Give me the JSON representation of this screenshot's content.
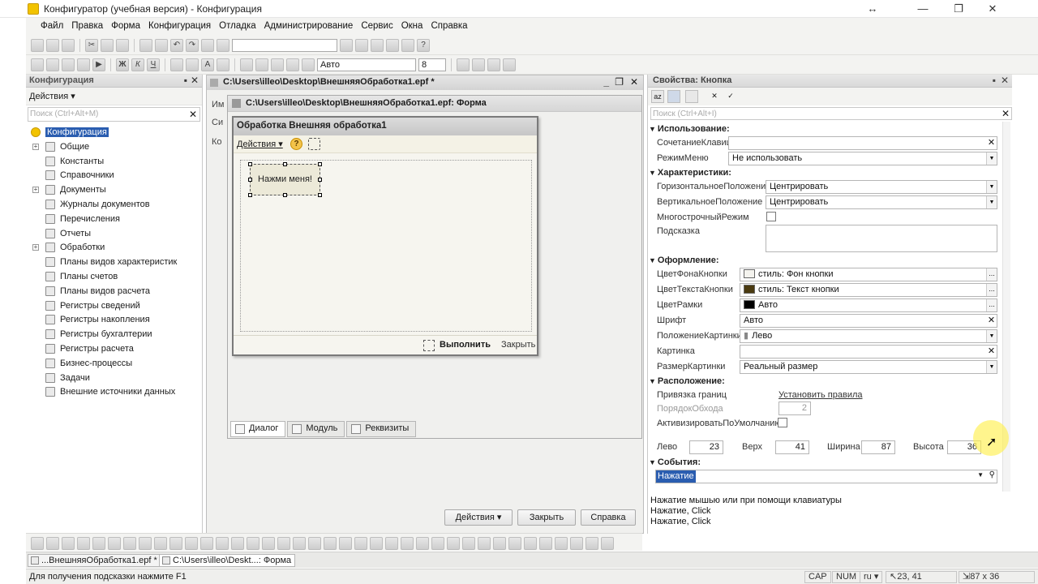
{
  "window": {
    "title": "Конфигуратор (учебная версия) - Конфигурация",
    "controls": [
      "↔",
      "—",
      "❐",
      "✕"
    ]
  },
  "menu": [
    "Файл",
    "Правка",
    "Форма",
    "Конфигурация",
    "Отладка",
    "Администрирование",
    "Сервис",
    "Окна",
    "Справка"
  ],
  "toolbar": {
    "font_name": "Авто",
    "font_size": "8"
  },
  "config_panel": {
    "title": "Конфигурация",
    "actions_label": "Действия",
    "search_placeholder": "Поиск (Ctrl+Alt+M)",
    "tree": [
      {
        "label": "Конфигурация",
        "root": true
      },
      {
        "label": "Общие",
        "expandable": true
      },
      {
        "label": "Константы"
      },
      {
        "label": "Справочники"
      },
      {
        "label": "Документы",
        "expandable": true
      },
      {
        "label": "Журналы документов"
      },
      {
        "label": "Перечисления"
      },
      {
        "label": "Отчеты"
      },
      {
        "label": "Обработки",
        "expandable": true
      },
      {
        "label": "Планы видов характеристик"
      },
      {
        "label": "Планы счетов"
      },
      {
        "label": "Планы видов расчета"
      },
      {
        "label": "Регистры сведений"
      },
      {
        "label": "Регистры накопления"
      },
      {
        "label": "Регистры бухгалтерии"
      },
      {
        "label": "Регистры расчета"
      },
      {
        "label": "Бизнес-процессы"
      },
      {
        "label": "Задачи"
      },
      {
        "label": "Внешние источники данных"
      }
    ]
  },
  "center_window": {
    "title": "C:\\Users\\illeo\\Desktop\\ВнешняяОбработка1.epf *",
    "side_labels": [
      "Им",
      "Си",
      "Ко"
    ],
    "buttons": {
      "actions": "Действия",
      "close": "Закрыть",
      "help": "Справка"
    }
  },
  "form_window": {
    "title": "C:\\Users\\illeo\\Desktop\\ВнешняяОбработка1.epf: Форма",
    "tabs": [
      "Диалог",
      "Модуль",
      "Реквизиты"
    ]
  },
  "processing_form": {
    "title": "Обработка  Внешняя обработка1",
    "actions_label": "Действия",
    "button_label": "Нажми меня!",
    "run_label": "Выполнить",
    "close_label": "Закрыть"
  },
  "properties": {
    "title": "Свойства: Кнопка",
    "search_placeholder": "Поиск (Ctrl+Alt+I)",
    "sections": {
      "usage": "Использование:",
      "characteristics": "Характеристики:",
      "appearance": "Оформление:",
      "location": "Расположение:",
      "events": "События:"
    },
    "rows": {
      "hotkey": {
        "label": "СочетаниеКлавиш",
        "value": ""
      },
      "menu_mode": {
        "label": "РежимМеню",
        "value": "Не использовать"
      },
      "h_pos": {
        "label": "ГоризонтальноеПоложение",
        "value": "Центрировать"
      },
      "v_pos": {
        "label": "ВертикальноеПоложение",
        "value": "Центрировать"
      },
      "multiline": {
        "label": "МногострочныйРежим"
      },
      "tooltip": {
        "label": "Подсказка",
        "value": ""
      },
      "bg_color": {
        "label": "ЦветФонаКнопки",
        "value": "стиль: Фон кнопки",
        "swatch": "#f4f3ee"
      },
      "text_color": {
        "label": "ЦветТекстаКнопки",
        "value": "стиль: Текст кнопки",
        "swatch": "#4a3a10"
      },
      "border_color": {
        "label": "ЦветРамки",
        "value": "Авто",
        "swatch": "#000000"
      },
      "font": {
        "label": "Шрифт",
        "value": "Авто"
      },
      "picture_pos": {
        "label": "ПоложениеКартинки",
        "value": "Лево"
      },
      "picture": {
        "label": "Картинка",
        "value": ""
      },
      "picture_size": {
        "label": "РазмерКартинки",
        "value": "Реальный размер"
      },
      "anchor": {
        "label": "Привязка границ",
        "value": "Установить правила"
      },
      "tab_order": {
        "label": "ПорядокОбхода",
        "value": "2"
      },
      "activate_default": {
        "label": "АктивизироватьПоУмолчанию"
      }
    },
    "geometry": {
      "left_label": "Лево",
      "left": "23",
      "top_label": "Верх",
      "top": "41",
      "width_label": "Ширина",
      "width": "87",
      "height_label": "Высота",
      "height": "36"
    },
    "event_selected": "Нажатие",
    "description": [
      "Нажатие мышью или при помощи клавиатуры",
      "Нажатие, Click",
      "Нажатие, Click"
    ]
  },
  "task_tabs": [
    "...ВнешняяОбработка1.epf *",
    "C:\\Users\\illeo\\Deskt...: Форма"
  ],
  "status": {
    "hint": "Для получения подсказки нажмите F1",
    "cap": "CAP",
    "num": "NUM",
    "lang": "ru",
    "position": "23, 41",
    "size": "87 x 36"
  }
}
